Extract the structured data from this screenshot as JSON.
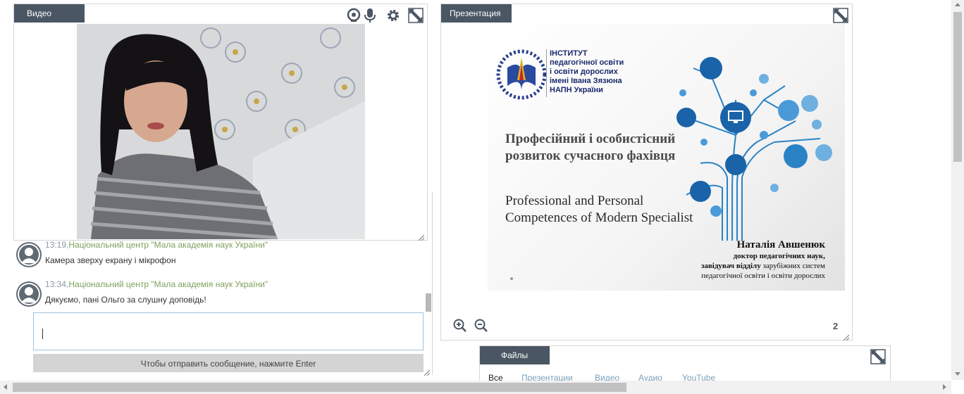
{
  "video_panel": {
    "title": "Видео",
    "icons": [
      "webcam-icon",
      "microphone-icon",
      "gear-icon",
      "fullscreen-icon"
    ]
  },
  "chat": {
    "messages": [
      {
        "time": "13:19,",
        "author": "Національний центр \"Мала академія наук України\"",
        "text": "Камера зверху екрану і мікрофон"
      },
      {
        "time": "13:34,",
        "author": "Національний центр \"Мала академія наук України\"",
        "text": "Дякуємо, пані Ольго за слушну доповідь!"
      }
    ],
    "input_value": "",
    "send_hint": "Чтобы отправить сообщение, нажмите Enter"
  },
  "presentation_panel": {
    "title": "Презентация",
    "page_number": "2",
    "slide": {
      "institute_lines": [
        "ІНСТИТУТ",
        "педагогічної освіти",
        "і освіти дорослих",
        "імені Івана Зязюна",
        "НАПН України"
      ],
      "title_ua_1": "Професійний і особистісний",
      "title_ua_2": "розвиток сучасного фахівця",
      "title_en_1": "Professional and Personal",
      "title_en_2": "Competences of Modern  Specialist",
      "author_name": "Наталія Авшенюк",
      "author_line_1": "доктор педагогічних наук,",
      "author_line_2_bold": "завідувач відділу",
      "author_line_2_rest": " зарубіжних систем",
      "author_line_3": "педагогічної освіти  і освіти дорослих"
    }
  },
  "files_panel": {
    "title": "Файлы",
    "tabs": [
      "Все",
      "Презентации",
      "Видео",
      "Аудио",
      "YouTube"
    ]
  },
  "colors": {
    "panel_tab": "#4a5663",
    "author_green": "#7ea05e",
    "link_blue": "#7aa0ba",
    "slide_blue": "#1e6fb3"
  }
}
